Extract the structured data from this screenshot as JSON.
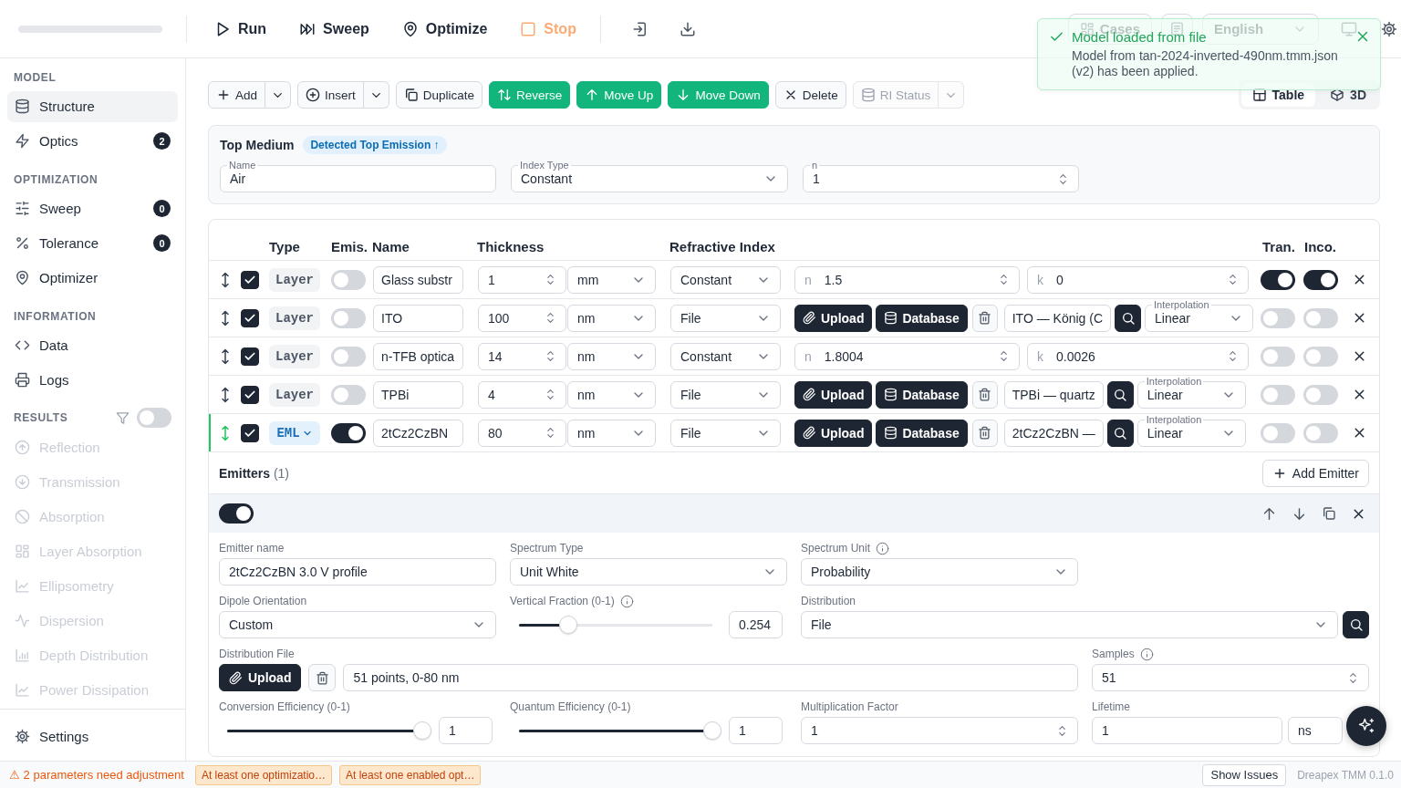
{
  "run_bar": {
    "actions": [
      {
        "label": "Run",
        "kind": "run",
        "disabled": false
      },
      {
        "label": "Sweep",
        "kind": "sweep",
        "disabled": false
      },
      {
        "label": "Optimize",
        "kind": "optimize",
        "disabled": false
      },
      {
        "label": "Stop",
        "kind": "stop",
        "disabled": true
      }
    ]
  },
  "header": {
    "cases": "Cases",
    "language": "English"
  },
  "toast": {
    "title": "Model loaded from file",
    "message": "Model from tan-2024-inverted-490nm.tmm.json (v2) has been applied."
  },
  "sidebar": {
    "sections": [
      {
        "title": "MODEL",
        "items": [
          {
            "label": "Structure",
            "kind": "structure",
            "selected": true,
            "disabled": false
          },
          {
            "label": "Optics",
            "kind": "optics",
            "selected": false,
            "disabled": false,
            "badge": "2"
          }
        ]
      },
      {
        "title": "OPTIMIZATION",
        "items": [
          {
            "label": "Sweep",
            "kind": "sweep",
            "selected": false,
            "disabled": false,
            "badge": "0"
          },
          {
            "label": "Tolerance",
            "kind": "tolerance",
            "selected": false,
            "disabled": false,
            "badge": "0"
          },
          {
            "label": "Optimizer",
            "kind": "optimizer",
            "selected": false,
            "disabled": false
          }
        ]
      },
      {
        "title": "INFORMATION",
        "items": [
          {
            "label": "Data",
            "kind": "data",
            "selected": false,
            "disabled": false
          },
          {
            "label": "Logs",
            "kind": "logs",
            "selected": false,
            "disabled": false
          }
        ]
      },
      {
        "title": "RESULTS",
        "filter_on": false,
        "items": [
          {
            "label": "Reflection",
            "kind": "reflection",
            "selected": false,
            "disabled": true
          },
          {
            "label": "Transmission",
            "kind": "transmission",
            "selected": false,
            "disabled": true
          },
          {
            "label": "Absorption",
            "kind": "absorption",
            "selected": false,
            "disabled": true
          },
          {
            "label": "Layer Absorption",
            "kind": "layers",
            "selected": false,
            "disabled": true
          },
          {
            "label": "Ellipsometry",
            "kind": "ellipsometry",
            "selected": false,
            "disabled": true
          },
          {
            "label": "Dispersion",
            "kind": "dispersion",
            "selected": false,
            "disabled": true
          },
          {
            "label": "Depth Distribution",
            "kind": "depth",
            "selected": false,
            "disabled": true
          },
          {
            "label": "Power Dissipation",
            "kind": "power",
            "selected": false,
            "disabled": true
          }
        ]
      }
    ],
    "settings": "Settings"
  },
  "toolbar": {
    "buttons": [
      {
        "label": "Add",
        "kind": "add",
        "primary": false,
        "menu": true,
        "disabled": false
      },
      {
        "label": "Insert",
        "kind": "insert",
        "primary": false,
        "menu": true,
        "disabled": false
      },
      {
        "label": "Duplicate",
        "kind": "duplicate",
        "primary": false,
        "menu": false,
        "disabled": false
      },
      {
        "label": "Reverse",
        "kind": "reverse",
        "primary": true,
        "menu": false,
        "disabled": false
      },
      {
        "label": "Move Up",
        "kind": "up",
        "primary": true,
        "menu": false,
        "disabled": false
      },
      {
        "label": "Move Down",
        "kind": "down",
        "primary": true,
        "menu": false,
        "disabled": false
      },
      {
        "label": "Delete",
        "kind": "delete",
        "primary": false,
        "menu": false,
        "disabled": false
      },
      {
        "label": "RI Status",
        "kind": "status",
        "primary": false,
        "menu": true,
        "disabled": true
      }
    ],
    "views": [
      {
        "label": "Table",
        "kind": "table",
        "selected": true
      },
      {
        "label": "3D",
        "kind": "cube",
        "selected": false
      }
    ]
  },
  "top_medium": {
    "title": "Top Medium",
    "badge": "Detected Top Emission ↑",
    "name": {
      "label": "Name",
      "value": "Air"
    },
    "index_type": {
      "label": "Index Type",
      "value": "Constant"
    },
    "n": {
      "label": "n",
      "value": "1"
    }
  },
  "layers": {
    "columns": [
      "Type",
      "Emis.",
      "Name",
      "Thickness",
      "Refractive Index",
      "Tran.",
      "Inco."
    ],
    "rows": [
      {
        "selected": false,
        "enabled": true,
        "type": "Layer",
        "emitter": false,
        "emissive": false,
        "name": "Glass substr",
        "thickness": "1",
        "unit": "mm",
        "index_type": "Constant",
        "kind": "constant",
        "n_label": "n",
        "n": "1.5",
        "k_label": "k",
        "k": "0",
        "transmissive": true,
        "incoherent": true
      },
      {
        "selected": false,
        "enabled": true,
        "type": "Layer",
        "emitter": false,
        "emissive": false,
        "name": "ITO",
        "thickness": "100",
        "unit": "nm",
        "index_type": "File",
        "kind": "file",
        "upload": "Upload",
        "database": "Database",
        "material": "ITO — König (C",
        "interpolation_label": "Interpolation",
        "interpolation": "Linear",
        "transmissive": false,
        "incoherent": false
      },
      {
        "selected": false,
        "enabled": true,
        "type": "Layer",
        "emitter": false,
        "emissive": false,
        "name": "n-TFB optica",
        "thickness": "14",
        "unit": "nm",
        "index_type": "Constant",
        "kind": "constant",
        "n_label": "n",
        "n": "1.8004",
        "k_label": "k",
        "k": "0.0026",
        "transmissive": false,
        "incoherent": false
      },
      {
        "selected": false,
        "enabled": true,
        "type": "Layer",
        "emitter": false,
        "emissive": false,
        "name": "TPBi",
        "thickness": "4",
        "unit": "nm",
        "index_type": "File",
        "kind": "file",
        "upload": "Upload",
        "database": "Database",
        "material": "TPBi — quartz",
        "interpolation_label": "Interpolation",
        "interpolation": "Linear",
        "transmissive": false,
        "incoherent": false
      },
      {
        "selected": true,
        "enabled": true,
        "type": "EML",
        "emitter": true,
        "emissive": true,
        "name": "2tCz2CzBN",
        "thickness": "80",
        "unit": "nm",
        "index_type": "File",
        "kind": "file",
        "upload": "Upload",
        "database": "Database",
        "material": "2tCz2CzBN —",
        "interpolation_label": "Interpolation",
        "interpolation": "Linear",
        "transmissive": false,
        "incoherent": false
      }
    ]
  },
  "emitters": {
    "title": "Emitters",
    "count": "(1)",
    "add": "Add Emitter",
    "items": [
      {
        "enabled": true,
        "name": {
          "label": "Emitter name",
          "value": "2tCz2CzBN 3.0 V profile"
        },
        "spectrum_type": {
          "label": "Spectrum Type",
          "value": "Unit White"
        },
        "spectrum_unit": {
          "label": "Spectrum Unit",
          "info": true,
          "value": "Probability"
        },
        "dipole": {
          "label": "Dipole Orientation",
          "value": "Custom"
        },
        "vertical_fraction": {
          "label": "Vertical Fraction (0-1)",
          "info": true,
          "level": 0.254,
          "reading": "0.254"
        },
        "distribution": {
          "label": "Distribution",
          "value": "File"
        },
        "distribution_file": {
          "label": "Distribution File",
          "upload": "Upload",
          "value": "51 points, 0-80 nm"
        },
        "samples": {
          "label": "Samples",
          "info": true,
          "value": "51"
        },
        "conversion": {
          "label": "Conversion Efficiency (0-1)",
          "level": 1,
          "reading": "1"
        },
        "quantum": {
          "label": "Quantum Efficiency (0-1)",
          "level": 1,
          "reading": "1"
        },
        "multiplication": {
          "label": "Multiplication Factor",
          "value": "1"
        },
        "lifetime": {
          "label": "Lifetime",
          "value": "1",
          "unit": "ns"
        }
      }
    ]
  },
  "status_bar": {
    "warning": "⚠ 2 parameters need adjustment",
    "tags": [
      "At least one optimizatio…",
      "At least one enabled opt…"
    ],
    "show_issues": "Show Issues",
    "version": "Dreapex TMM 0.1.0"
  }
}
